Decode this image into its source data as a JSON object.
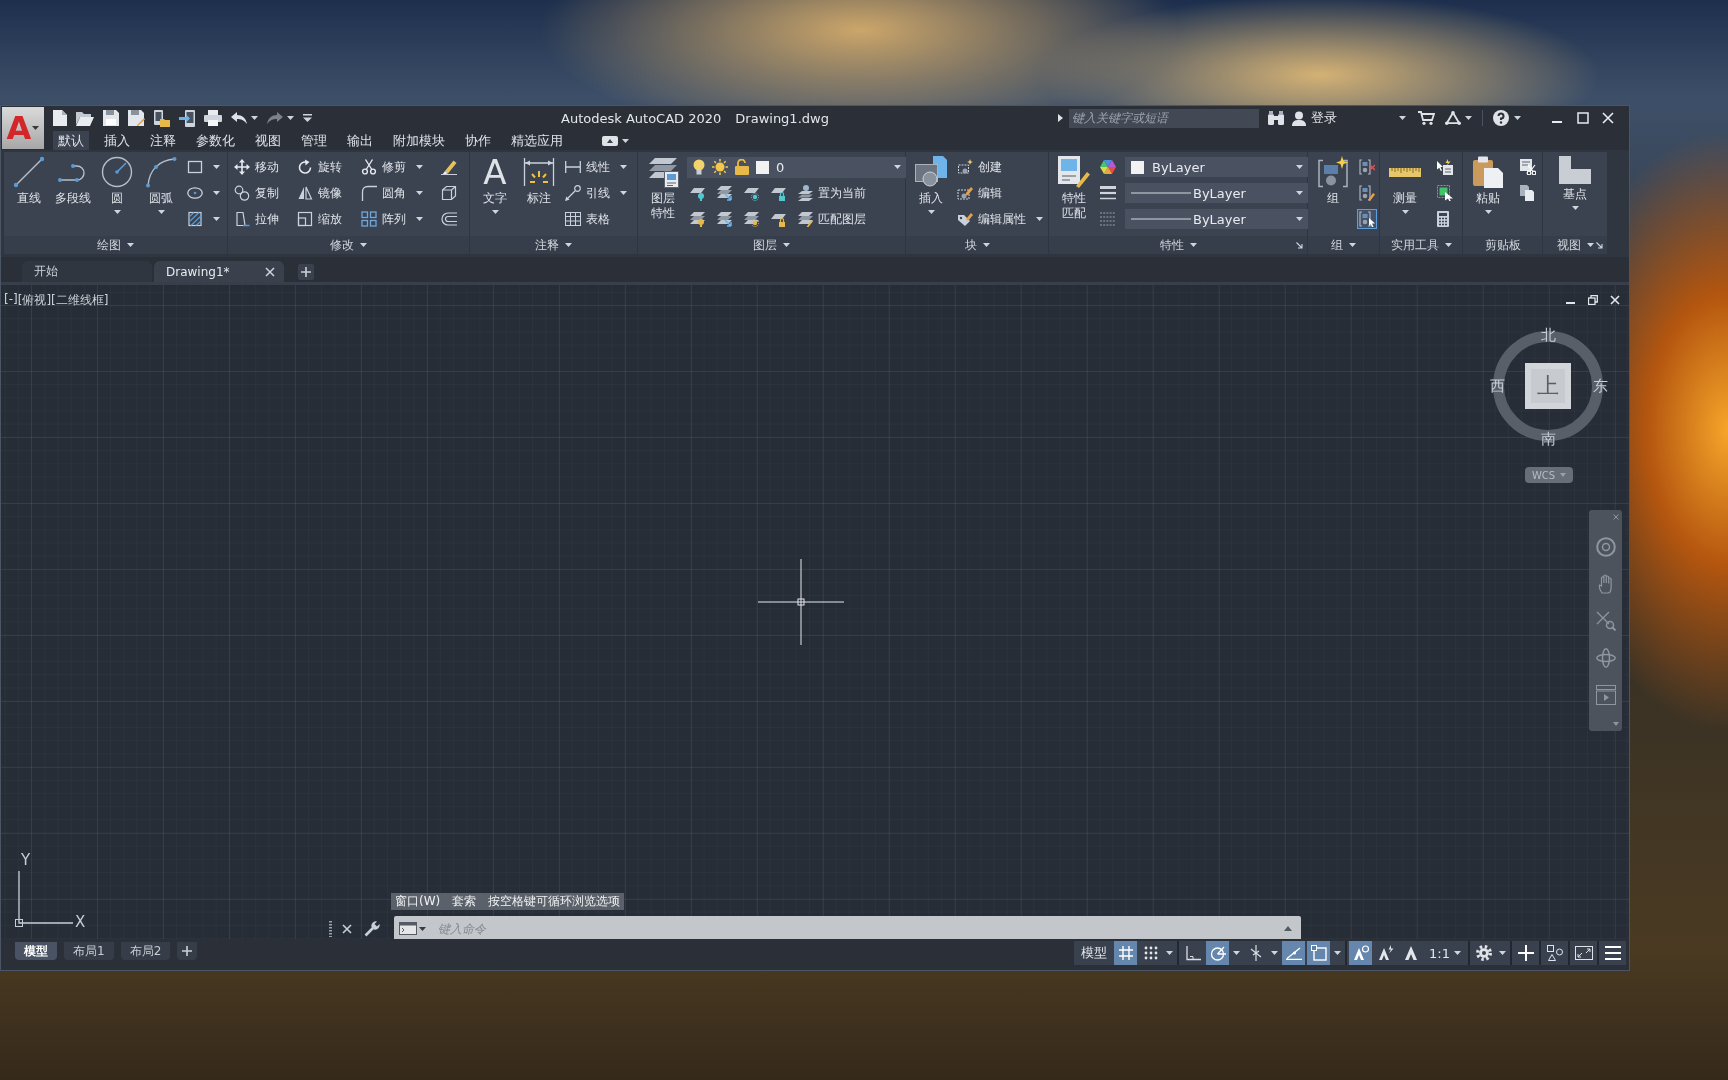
{
  "app_button": {
    "glyph": "A"
  },
  "window": {
    "title": "Autodesk AutoCAD 2020",
    "document": "Drawing1.dwg"
  },
  "search": {
    "placeholder": "键入关键字或短语"
  },
  "account": {
    "label": "登录"
  },
  "ribbon_tabs": [
    {
      "label": "默认",
      "selected": true
    },
    {
      "label": "插入",
      "selected": false
    },
    {
      "label": "注释",
      "selected": false
    },
    {
      "label": "参数化",
      "selected": false
    },
    {
      "label": "视图",
      "selected": false
    },
    {
      "label": "管理",
      "selected": false
    },
    {
      "label": "输出",
      "selected": false
    },
    {
      "label": "附加模块",
      "selected": false
    },
    {
      "label": "协作",
      "selected": false
    },
    {
      "label": "精选应用",
      "selected": false
    }
  ],
  "ribbon_panels": [
    {
      "title": "绘图",
      "menu": true,
      "launcher": false,
      "columns": [
        {
          "kind": "large",
          "label": "直线",
          "caret": false
        },
        {
          "kind": "large",
          "label": "多段线",
          "caret": false
        },
        {
          "kind": "large",
          "label": "圆",
          "caret": true
        },
        {
          "kind": "large",
          "label": "圆弧",
          "caret": true
        },
        {
          "kind": "stack",
          "rows": [
            [
              {
                "kind": "button",
                "caret": true
              }
            ],
            [
              {
                "kind": "button",
                "caret": true
              }
            ],
            [
              {
                "kind": "button",
                "caret": true
              }
            ]
          ]
        }
      ]
    },
    {
      "title": "修改",
      "menu": true,
      "launcher": false,
      "columns": [
        {
          "kind": "stack",
          "rows": [
            [
              {
                "kind": "button",
                "label": "移动",
                "caret": false
              }
            ],
            [
              {
                "kind": "button",
                "label": "复制",
                "caret": false
              }
            ],
            [
              {
                "kind": "button",
                "label": "拉伸",
                "caret": false
              }
            ]
          ]
        },
        {
          "kind": "stack",
          "rows": [
            [
              {
                "kind": "button",
                "label": "旋转",
                "caret": false
              }
            ],
            [
              {
                "kind": "button",
                "label": "镜像",
                "caret": false
              }
            ],
            [
              {
                "kind": "button",
                "label": "缩放",
                "caret": false
              }
            ]
          ]
        },
        {
          "kind": "stack",
          "rows": [
            [
              {
                "kind": "button",
                "label": "修剪",
                "caret": true
              }
            ],
            [
              {
                "kind": "button",
                "label": "圆角",
                "caret": true
              }
            ],
            [
              {
                "kind": "button",
                "label": "阵列",
                "caret": true
              }
            ]
          ]
        },
        {
          "kind": "stack",
          "rows": [
            [
              {
                "kind": "button",
                "caret": false
              }
            ],
            [
              {
                "kind": "button",
                "caret": false
              }
            ],
            [
              {
                "kind": "button",
                "caret": false
              }
            ]
          ]
        }
      ]
    },
    {
      "title": "注释",
      "menu": true,
      "launcher": false,
      "columns": [
        {
          "kind": "large",
          "glyph": "A",
          "label": "文字",
          "caret": true
        },
        {
          "kind": "large",
          "label": "标注",
          "caret": false
        },
        {
          "kind": "stack",
          "rows": [
            [
              {
                "kind": "button",
                "label": "线性",
                "caret": true
              }
            ],
            [
              {
                "kind": "button",
                "label": "引线",
                "caret": true
              }
            ],
            [
              {
                "kind": "button",
                "label": "表格",
                "caret": false
              }
            ]
          ]
        }
      ]
    },
    {
      "title": "图层",
      "menu": true,
      "launcher": false,
      "columns": [
        {
          "kind": "large",
          "label": "图层特性",
          "caret": false
        },
        {
          "kind": "stack",
          "rows": [
            [
              {
                "kind": "layer_select",
                "value": "0",
                "color": "#f2f2f2"
              }
            ],
            [
              {
                "kind": "button",
                "caret": false
              },
              {
                "kind": "button",
                "caret": false
              },
              {
                "kind": "button",
                "caret": false
              },
              {
                "kind": "button",
                "caret": false
              },
              {
                "kind": "button",
                "label": "置为当前",
                "caret": false
              }
            ],
            [
              {
                "kind": "button",
                "caret": false
              },
              {
                "kind": "button",
                "caret": false
              },
              {
                "kind": "button",
                "caret": false
              },
              {
                "kind": "button",
                "caret": false
              },
              {
                "kind": "button",
                "label": "匹配图层",
                "caret": false
              }
            ]
          ]
        }
      ]
    },
    {
      "title": "块",
      "menu": true,
      "launcher": false,
      "columns": [
        {
          "kind": "large",
          "label": "插入",
          "caret": true
        },
        {
          "kind": "stack",
          "rows": [
            [
              {
                "kind": "button",
                "label": "创建",
                "caret": false
              }
            ],
            [
              {
                "kind": "button",
                "label": "编辑",
                "caret": false
              }
            ],
            [
              {
                "kind": "button",
                "label": "编辑属性",
                "caret": true
              }
            ]
          ]
        }
      ]
    },
    {
      "title": "特性",
      "menu": true,
      "launcher": true,
      "columns": [
        {
          "kind": "large",
          "label": "特性匹配",
          "caret": false
        },
        {
          "kind": "stack",
          "rows": [
            [
              {
                "kind": "button",
                "caret": false
              },
              {
                "kind": "color_select",
                "value": "ByLayer",
                "color": "#f2f2f2"
              }
            ],
            [
              {
                "kind": "button",
                "caret": false
              },
              {
                "kind": "line_select",
                "value": "ByLayer"
              }
            ],
            [
              {
                "kind": "button",
                "caret": false
              },
              {
                "kind": "line_select",
                "value": "ByLayer"
              }
            ]
          ]
        }
      ]
    },
    {
      "title": "组",
      "menu": true,
      "launcher": false,
      "columns": [
        {
          "kind": "large",
          "label": "组",
          "caret": false
        },
        {
          "kind": "stack",
          "rows": [
            [
              {
                "kind": "button",
                "caret": false,
                "on": false
              }
            ],
            [
              {
                "kind": "button",
                "caret": false,
                "on": false
              }
            ],
            [
              {
                "kind": "button",
                "caret": false,
                "on": true
              }
            ]
          ]
        }
      ]
    },
    {
      "title": "实用工具",
      "menu": true,
      "launcher": false,
      "columns": [
        {
          "kind": "large",
          "label": "测量",
          "caret": true
        },
        {
          "kind": "stack",
          "rows": [
            [
              {
                "kind": "button",
                "caret": false
              }
            ],
            [
              {
                "kind": "button",
                "caret": false
              }
            ],
            [
              {
                "kind": "button",
                "caret": false
              }
            ]
          ]
        }
      ]
    },
    {
      "title": "剪贴板",
      "menu": false,
      "launcher": false,
      "columns": [
        {
          "kind": "large",
          "label": "粘贴",
          "caret": true
        },
        {
          "kind": "stack",
          "rows": [
            [
              {
                "kind": "button",
                "caret": false
              }
            ],
            [
              {
                "kind": "button",
                "caret": false
              }
            ]
          ]
        }
      ]
    },
    {
      "title": "视图",
      "menu": true,
      "launcher": true,
      "columns": [
        {
          "kind": "large",
          "label": "基点",
          "caret": true
        }
      ]
    }
  ],
  "file_tabs": [
    {
      "label": "开始",
      "selected": false,
      "closable": false
    },
    {
      "label": "Drawing1*",
      "selected": true,
      "closable": true
    }
  ],
  "viewport": {
    "controls": [
      "[-]",
      "[俯视]",
      "[二维线框]"
    ]
  },
  "viewcube": {
    "top": "上",
    "north": "北",
    "south": "南",
    "west": "西",
    "east": "东",
    "ucs": "WCS"
  },
  "ucs_icon": {
    "x_label": "X",
    "y_label": "Y"
  },
  "command_line": {
    "hints": [
      "窗口(W)",
      "套索",
      "按空格键可循环浏览选项"
    ],
    "placeholder": "键入命令"
  },
  "layout_tabs": [
    {
      "label": "模型",
      "selected": true
    },
    {
      "label": "布局1",
      "selected": false
    },
    {
      "label": "布局2",
      "selected": false
    }
  ],
  "status_bar": {
    "groups": [
      [
        {
          "kind": "text",
          "label": "模型",
          "caret": false
        },
        {
          "kind": "toggle",
          "on": true
        },
        {
          "kind": "toggle",
          "on": false
        },
        {
          "kind": "caret"
        }
      ],
      [
        {
          "kind": "toggle",
          "on": false
        },
        {
          "kind": "toggle",
          "on": true
        },
        {
          "kind": "caret"
        },
        {
          "kind": "toggle",
          "on": false
        },
        {
          "kind": "caret"
        },
        {
          "kind": "toggle",
          "on": true
        },
        {
          "kind": "toggle",
          "on": true
        },
        {
          "kind": "caret"
        }
      ],
      [
        {
          "kind": "toggle",
          "on": true
        },
        {
          "kind": "toggle",
          "on": false
        },
        {
          "kind": "toggle",
          "on": false
        },
        {
          "kind": "text",
          "label": "1:1",
          "caret": true
        }
      ],
      [
        {
          "kind": "button"
        },
        {
          "kind": "caret"
        }
      ],
      [
        {
          "kind": "button"
        }
      ],
      [
        {
          "kind": "button"
        }
      ],
      [
        {
          "kind": "button"
        }
      ],
      [
        {
          "kind": "button"
        }
      ]
    ]
  }
}
